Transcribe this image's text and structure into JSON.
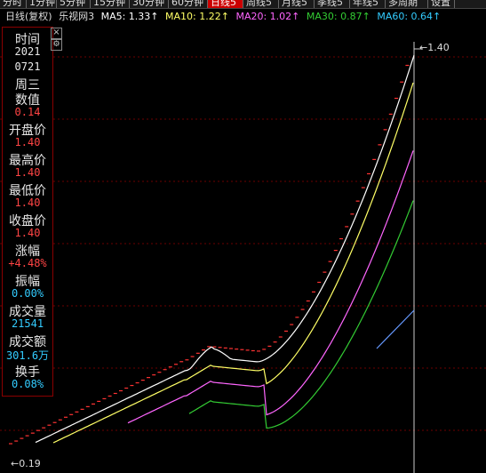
{
  "tabs": [
    "分时",
    "1分钟",
    "5分钟",
    "15分钟",
    "30分钟",
    "60分钟",
    "日线5",
    "周线5",
    "月线5",
    "季线5",
    "年线5",
    "多周期",
    "设置"
  ],
  "legend": {
    "period": "日线(复权)",
    "name": "乐视网3",
    "ma5": "MA5: 1.33↑",
    "ma10": "MA10: 1.22↑",
    "ma20": "MA20: 1.02↑",
    "ma30": "MA30: 0.87↑",
    "ma60": "MA60: 0.64↑"
  },
  "colors": {
    "ma5": "#ffffff",
    "ma10": "#ffff66",
    "ma20": "#ff66ff",
    "ma30": "#33cc33",
    "ma60": "#6699ff",
    "up": "#ff4444"
  },
  "info": {
    "close_icon": "close-icon",
    "settings_icon": "gear-icon",
    "rows": [
      {
        "label": "时间",
        "value": "2021",
        "color": "#e8e8e8"
      },
      {
        "label": "",
        "value": "0721",
        "color": "#e8e8e8"
      },
      {
        "label": "周三",
        "value": "",
        "color": "#e8e8e8"
      },
      {
        "label": "数值",
        "value": "0.14",
        "color": "#ff4444"
      },
      {
        "label": "开盘价",
        "value": "1.40",
        "color": "#ff4444"
      },
      {
        "label": "最高价",
        "value": "1.40",
        "color": "#ff4444"
      },
      {
        "label": "最低价",
        "value": "1.40",
        "color": "#ff4444"
      },
      {
        "label": "收盘价",
        "value": "1.40",
        "color": "#ff4444"
      },
      {
        "label": "涨幅",
        "value": "+4.48%",
        "color": "#ff4444"
      },
      {
        "label": "振幅",
        "value": "0.00%",
        "color": "#33ccff"
      },
      {
        "label": "成交量",
        "value": "21541",
        "color": "#33ccff"
      },
      {
        "label": "成交额",
        "value": "301.6万",
        "color": "#33ccff"
      },
      {
        "label": "换手",
        "value": "0.08%",
        "color": "#33ccff"
      }
    ]
  },
  "chart": {
    "high_label": "1.40",
    "low_label": "0.19"
  }
}
